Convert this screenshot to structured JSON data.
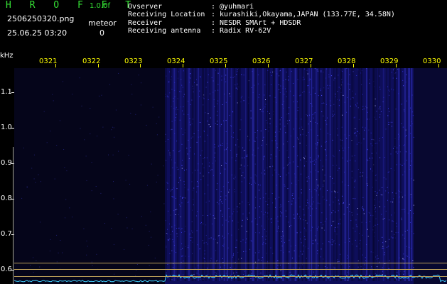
{
  "app": {
    "title": "H R O F F T",
    "version": "1.0.0f"
  },
  "file_name": "2506250320.png",
  "datetime": "25.06.25 03:20",
  "meteor": {
    "label": "meteor",
    "count": "0"
  },
  "info": [
    {
      "key": "Ovserver",
      "value": ": @yuhmari"
    },
    {
      "key": "Receiving Location",
      "value": ": kurashiki,Okayama,JAPAN (133.77E, 34.58N)"
    },
    {
      "key": "Receiver",
      "value": ": NESDR SMArt + HDSDR"
    },
    {
      "key": "Receiving antenna",
      "value": ": Radix RV-62V"
    }
  ],
  "axis": {
    "unit": "kHz",
    "y_labels": [
      "1.1",
      "1.0",
      "0.9",
      "0.8",
      "0.7",
      "0.6"
    ],
    "time_labels": [
      "0321",
      "0322",
      "0323",
      "0324",
      "0325",
      "0326",
      "0327",
      "0328",
      "0329",
      "0330"
    ]
  },
  "colors": {
    "title": "#35e035",
    "time_labels": "#ffff00",
    "noise": "#3030d0",
    "signal": "#40d0ff"
  }
}
